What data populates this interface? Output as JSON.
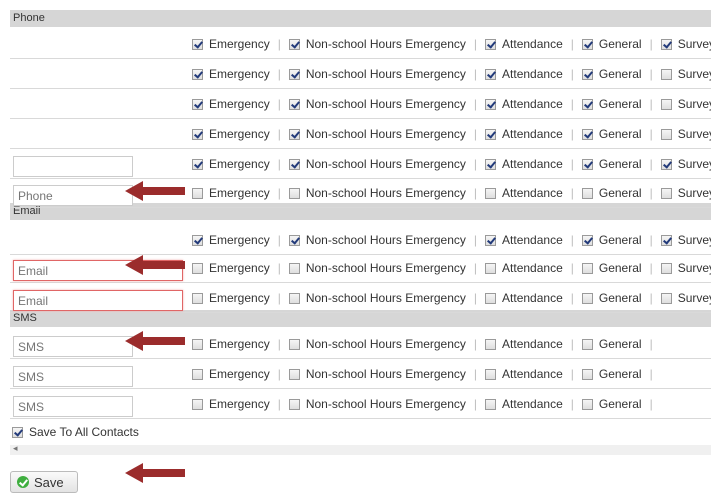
{
  "sections": {
    "phone": "Phone",
    "email": "Email",
    "sms": "SMS"
  },
  "option_labels": {
    "emergency": "Emergency",
    "non_school": "Non-school Hours Emergency",
    "attendance": "Attendance",
    "general": "General",
    "survey": "Survey"
  },
  "rows": [
    {
      "type": "phone",
      "input": null,
      "checks": [
        true,
        true,
        true,
        true,
        true
      ],
      "arrow": false
    },
    {
      "type": "phone",
      "input": null,
      "checks": [
        true,
        true,
        true,
        true,
        false
      ],
      "arrow": false
    },
    {
      "type": "phone",
      "input": null,
      "checks": [
        true,
        true,
        true,
        true,
        false
      ],
      "arrow": false
    },
    {
      "type": "phone",
      "input": null,
      "checks": [
        true,
        true,
        true,
        true,
        false
      ],
      "arrow": false
    },
    {
      "type": "phone",
      "input": {
        "value": "",
        "placeholder": "",
        "error": false
      },
      "checks": [
        true,
        true,
        true,
        true,
        true
      ],
      "arrow": false
    },
    {
      "type": "phone",
      "input": {
        "value": "",
        "placeholder": "Phone",
        "error": false
      },
      "checks": [
        false,
        false,
        false,
        false,
        false
      ],
      "arrow": true
    },
    {
      "type": "email",
      "input": null,
      "checks": [
        true,
        true,
        true,
        true,
        true
      ],
      "arrow": false
    },
    {
      "type": "email",
      "input": {
        "value": "",
        "placeholder": "Email",
        "error": true
      },
      "checks": [
        false,
        false,
        false,
        false,
        false
      ],
      "arrow": true
    },
    {
      "type": "email",
      "input": {
        "value": "",
        "placeholder": "Email",
        "error": true
      },
      "checks": [
        false,
        false,
        false,
        false,
        false
      ],
      "arrow": false
    },
    {
      "type": "sms",
      "input": {
        "value": "",
        "placeholder": "SMS",
        "error": false
      },
      "checks": [
        false,
        false,
        false,
        false
      ],
      "arrow": true
    },
    {
      "type": "sms",
      "input": {
        "value": "",
        "placeholder": "SMS",
        "error": false
      },
      "checks": [
        false,
        false,
        false,
        false
      ],
      "arrow": false
    },
    {
      "type": "sms",
      "input": {
        "value": "",
        "placeholder": "SMS",
        "error": false
      },
      "checks": [
        false,
        false,
        false,
        false
      ],
      "arrow": false
    }
  ],
  "save_all": {
    "label": "Save To All Contacts",
    "checked": true
  },
  "scroll_arrow": "◂",
  "save_button": {
    "label": "Save",
    "icon": "check-circle-icon"
  },
  "colors": {
    "arrow": "#9b2c2c",
    "section_bg": "#d6d6d6",
    "error_border": "#e06666",
    "ok_green": "#3fae3f"
  }
}
